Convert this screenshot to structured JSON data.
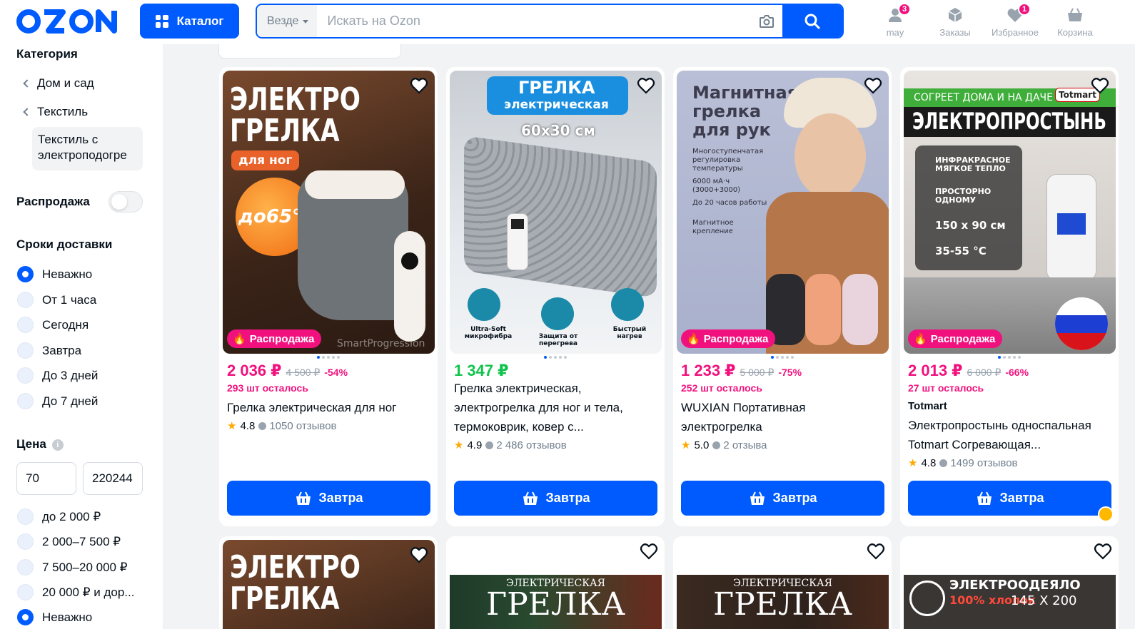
{
  "header": {
    "logo": "OZON",
    "catalog_label": "Каталог",
    "search_scope": "Везде",
    "search_placeholder": "Искать на Ozon",
    "icons": [
      {
        "label": "may",
        "badge": "3",
        "icon": "user-icon"
      },
      {
        "label": "Заказы",
        "badge": "",
        "icon": "box-icon"
      },
      {
        "label": "Избранное",
        "badge": "1",
        "icon": "heart-icon"
      },
      {
        "label": "Корзина",
        "badge": "",
        "icon": "cart-icon"
      }
    ]
  },
  "sidebar": {
    "category_title": "Категория",
    "breadcrumbs": [
      "Дом и сад",
      "Текстиль"
    ],
    "active_category": "Текстиль с электроподогре",
    "sale_label": "Распродажа",
    "delivery_title": "Сроки доставки",
    "delivery_options": [
      "Неважно",
      "От 1 часа",
      "Сегодня",
      "Завтра",
      "До 3 дней",
      "До 7 дней"
    ],
    "delivery_selected": "Неважно",
    "price_title": "Цена",
    "price_from": "70",
    "price_to": "220244",
    "price_options": [
      "до 2 000 ₽",
      "2 000–7 500 ₽",
      "7 500–20 000 ₽",
      "20 000 ₽ и дор..."
    ],
    "next_option": "Неважно"
  },
  "products": [
    {
      "price": "2 036 ₽",
      "old_price": "4 500 ₽",
      "discount": "-54%",
      "price_color": "pink",
      "stock": "293 шт осталось",
      "brand": "",
      "title": "Грелка электрическая для ног",
      "rating": "4.8",
      "reviews": "1050 отзывов",
      "sale_badge": "Распродажа",
      "buy_label": "Завтра",
      "art": {
        "line1": "ЭЛЕКТРО",
        "line2": "ГРЕЛКА",
        "sub": "для ног",
        "temp": "до65°С",
        "watermark": "SmartProgression"
      }
    },
    {
      "price": "1 347 ₽",
      "old_price": "",
      "discount": "",
      "price_color": "green",
      "stock": "",
      "brand": "",
      "title": "Грелка электрическая, электрогрелка для ног и тела, термоковрик, ковер с...",
      "rating": "4.9",
      "reviews": "2 486 отзывов",
      "sale_badge": "",
      "buy_label": "Завтра",
      "art": {
        "line1": "ГРЕЛКА",
        "line2": "электрическая",
        "size": "60х30 см",
        "f1": "Ultra-Soft микрофибра",
        "f2": "Защита от перегрева",
        "f3": "Быстрый нагрев"
      }
    },
    {
      "price": "1 233 ₽",
      "old_price": "5 000 ₽",
      "discount": "-75%",
      "price_color": "pink",
      "stock": "252 шт осталось",
      "brand": "",
      "title": "WUXIAN Портативная электрогрелка",
      "rating": "5.0",
      "reviews": "2 отзыва",
      "sale_badge": "Распродажа",
      "buy_label": "Завтра",
      "art": {
        "title": "Магнитная грелка для рук",
        "b1": "Многоступенчатая регулировка температуры",
        "b2": "6000 мА·ч (3000+3000)",
        "b3": "До 20 часов работы",
        "b4": "Магнитное крепление"
      }
    },
    {
      "price": "2 013 ₽",
      "old_price": "6 000 ₽",
      "discount": "-66%",
      "price_color": "pink",
      "stock": "27 шт осталось",
      "brand": "Totmart",
      "title": "Электропростынь односпальная Totmart Согревающая...",
      "rating": "4.8",
      "reviews": "1499 отзывов",
      "sale_badge": "Распродажа",
      "buy_label": "Завтра",
      "art": {
        "top": "СОГРЕЕТ ДОМА И НА ДАЧЕ",
        "logo": "Totmart",
        "head": "ЭЛЕКТРОПРОСТЫНЬ",
        "f1": "ИНФРАКРАСНОЕ МЯГКОЕ ТЕПЛО",
        "f2": "ПРОСТОРНО ОДНОМУ",
        "f3": "150 х 90 см",
        "f4": "35-55 °С",
        "made": "сделано в России"
      }
    }
  ],
  "row2": [
    {
      "line1": "ЭЛЕКТРО",
      "line2": "ГРЕЛКА"
    },
    {
      "line1": "ЭЛЕКТРИЧЕСКАЯ",
      "line2": "ГРЕЛКА"
    },
    {
      "line1": "ЭЛЕКТРИЧЕСКАЯ",
      "line2": "ГРЕЛКА"
    },
    {
      "line1": "ЭЛЕКТРООДЕЯЛО",
      "line2": "145 Х 200",
      "pct": "100% хлопок"
    }
  ],
  "colors": {
    "brand_blue": "#005bff",
    "sale_pink": "#f1117e",
    "price_green": "#10c44c"
  }
}
